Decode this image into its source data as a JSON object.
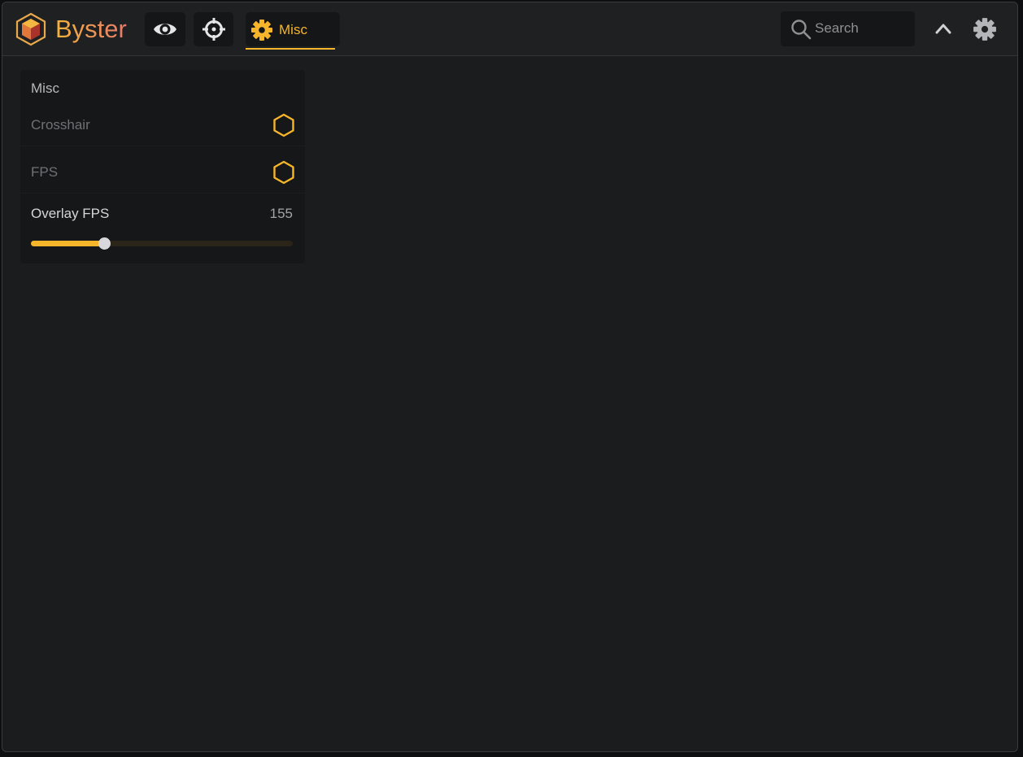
{
  "app": {
    "brand_name": "Byster",
    "accent_color": "#f6b52a"
  },
  "tabs": [
    {
      "icon": "eye-icon",
      "label": ""
    },
    {
      "icon": "crosshair-icon",
      "label": ""
    },
    {
      "icon": "gear-icon",
      "label": "Misc",
      "active": true
    }
  ],
  "search": {
    "placeholder": "Search",
    "value": ""
  },
  "header_actions": [
    {
      "icon": "chevron-up-icon"
    },
    {
      "icon": "settings-gear-icon"
    }
  ],
  "panel": {
    "title": "Misc",
    "toggles": [
      {
        "label": "Crosshair",
        "icon": "hexagon-checkbox-icon",
        "checked": false
      },
      {
        "label": "FPS",
        "icon": "hexagon-checkbox-icon",
        "checked": false
      }
    ],
    "slider": {
      "label": "Overlay FPS",
      "value": "155",
      "fill_fraction": 0.28
    }
  }
}
